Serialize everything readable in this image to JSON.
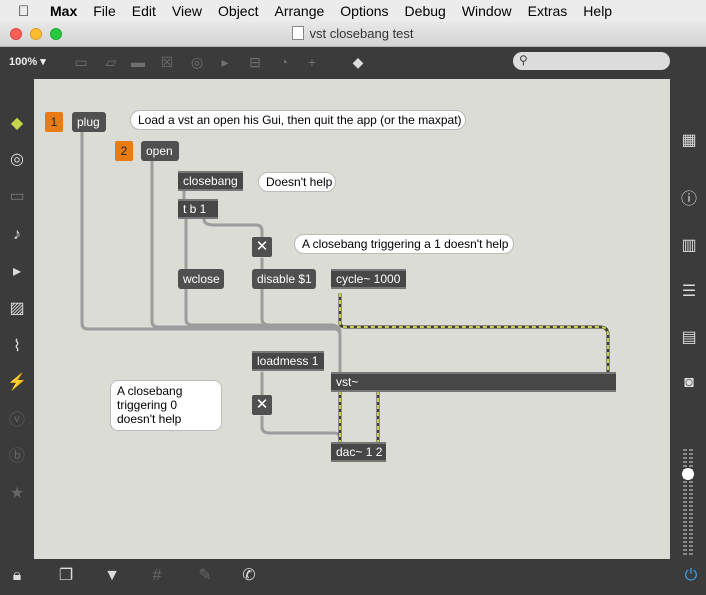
{
  "menubar": {
    "apple": "",
    "items": [
      "Max",
      "File",
      "Edit",
      "View",
      "Object",
      "Arrange",
      "Options",
      "Debug",
      "Window",
      "Extras",
      "Help"
    ]
  },
  "window": {
    "title": "vst closebang test"
  },
  "toolbar": {
    "zoom": "100% ▾",
    "search_placeholder": "",
    "icons": [
      "presentation-icon",
      "message-icon",
      "comment-icon",
      "toggle-icon",
      "button-icon",
      "umenu-icon",
      "slider-icon",
      "dial-icon",
      "add-icon",
      "paint-icon"
    ]
  },
  "patch": {
    "badge1": "1",
    "badge2": "2",
    "plug": "plug",
    "open": "open",
    "closebang": "closebang",
    "tb1": "t b 1",
    "wclose": "wclose",
    "disable": "disable $1",
    "cycle": "cycle~ 1000",
    "loadmess": "loadmess 1",
    "vst": "vst~",
    "dac": "dac~ 1 2",
    "toggle_glyph": "✕",
    "comment_load": "Load a vst an open his Gui, then quit the app (or the maxpat)",
    "comment_doesnt": "Doesn't help",
    "comment_closebang1": "A closebang triggering a 1 doesn't help",
    "comment_closebang0": "A closebang triggering 0 doesn't help"
  },
  "colors": {
    "canvas": "#dcdcd6",
    "object": "#505050",
    "badge": "#e87b13",
    "signal_cable": "#c7d04a",
    "chrome": "#3b3b3b"
  }
}
